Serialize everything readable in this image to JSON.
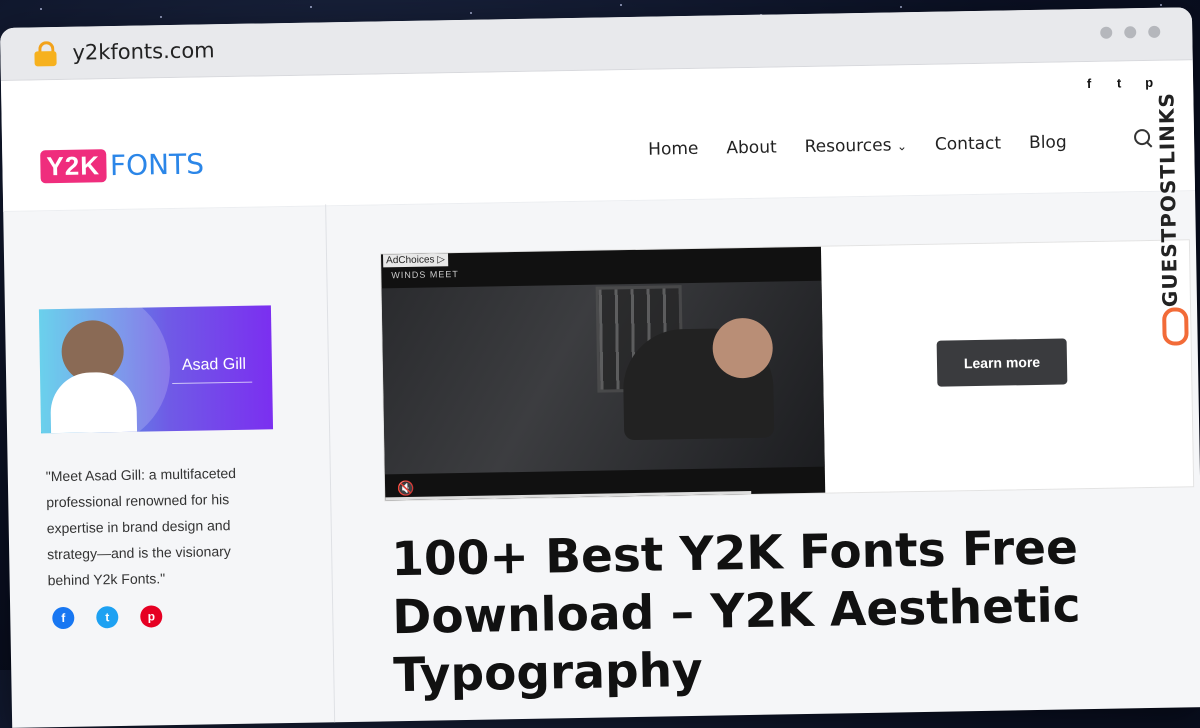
{
  "browser": {
    "url": "y2kfonts.com"
  },
  "header": {
    "logo_badge": "Y2K",
    "logo_word": "FONTS",
    "social_top": [
      "f",
      "t",
      "p"
    ],
    "nav": [
      "Home",
      "About",
      "Resources",
      "Contact",
      "Blog"
    ],
    "resources_caret": "⌄"
  },
  "sidebar": {
    "author_name": "Asad Gill",
    "bio": "\"Meet Asad Gill: a multifaceted professional renowned for his expertise in brand design and strategy—and is the visionary behind Y2k Fonts.\"",
    "social": [
      "f",
      "t",
      "p"
    ]
  },
  "ad": {
    "adchoices": "AdChoices ▷",
    "game_title": "WINDS MEET",
    "mute_icon": "🔇",
    "cta": "Learn more"
  },
  "article": {
    "title": "100+ Best Y2K Fonts Free Download – Y2K Aesthetic Typography"
  },
  "watermark": {
    "text": "GUESTPOSTLINKS"
  },
  "colors": {
    "brand_pink": "#ef2d7d",
    "brand_blue": "#2b86e8",
    "accent_orange": "#f26b38"
  }
}
